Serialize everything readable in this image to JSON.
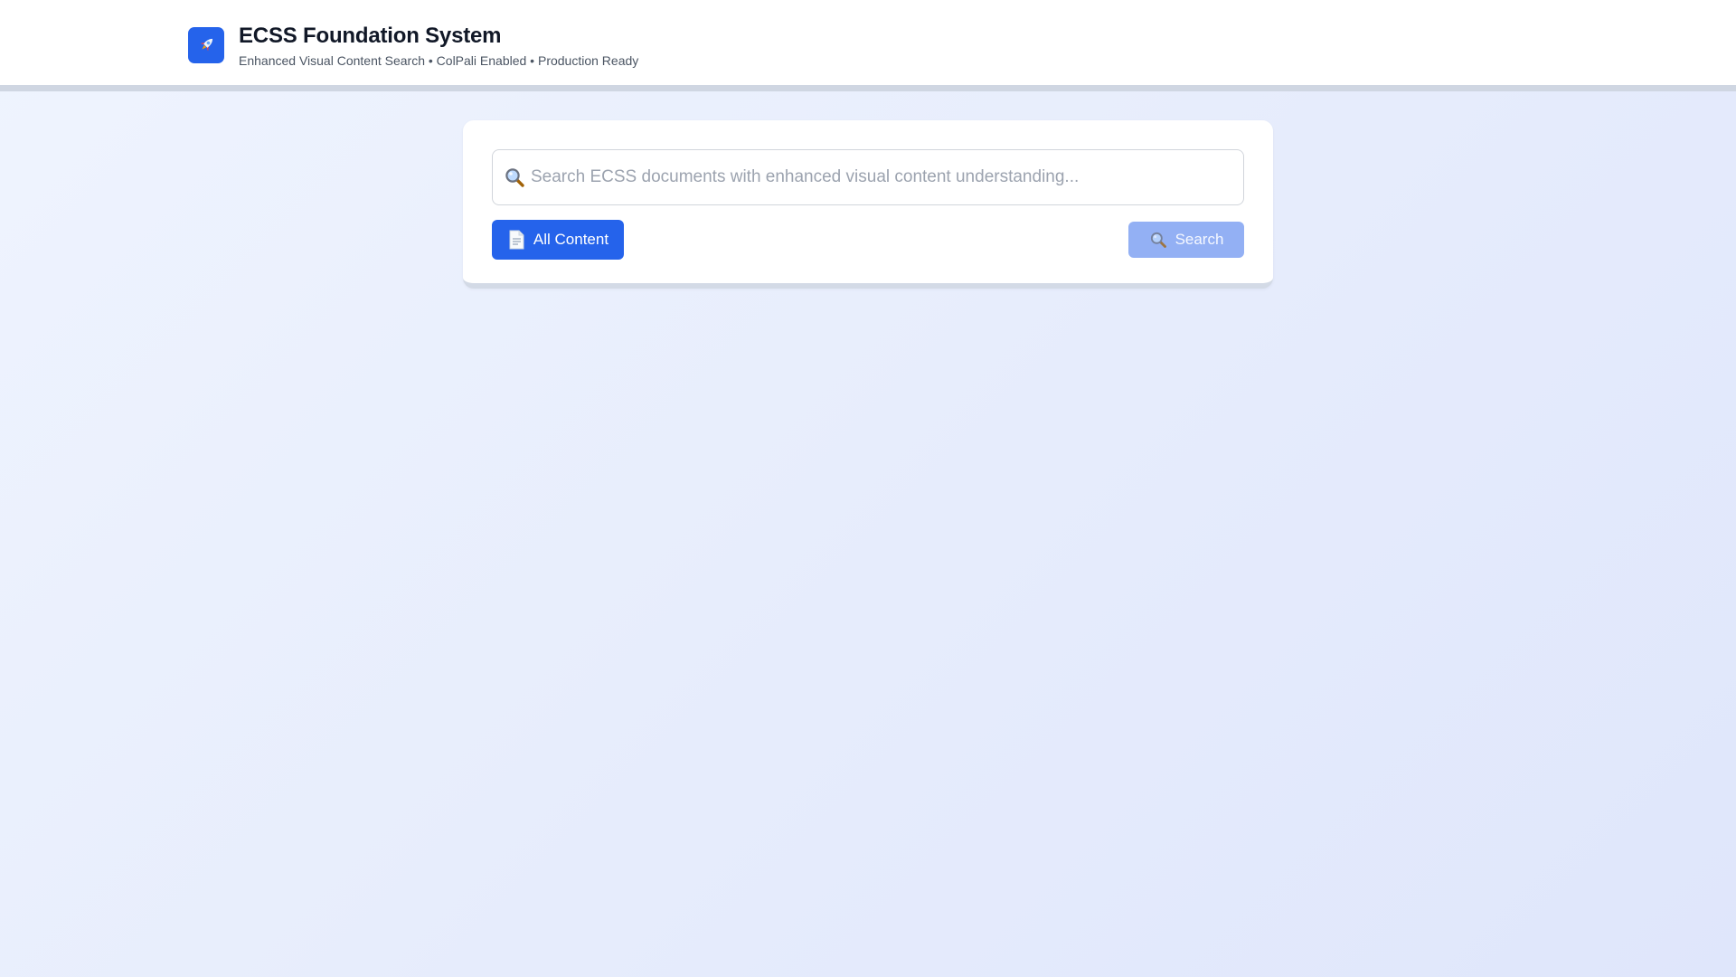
{
  "header": {
    "logo_icon": "rocket-icon",
    "title": "ECSS Foundation System",
    "subtitle": "Enhanced Visual Content Search • ColPali Enabled • Production Ready"
  },
  "search": {
    "input_icon": "magnifier-icon",
    "placeholder": "Search ECSS documents with enhanced visual content understanding...",
    "value": "",
    "filter_button": {
      "icon": "document-icon",
      "label": "All Content"
    },
    "submit_button": {
      "icon": "magnifier-icon",
      "label": "Search",
      "state": "disabled"
    }
  },
  "colors": {
    "accent": "#2563eb",
    "accent_disabled": "#93b0f4",
    "page_background": "#e8eefc",
    "title_text": "#111827",
    "subtitle_text": "#4b5563",
    "placeholder_text": "#9ca3af"
  }
}
